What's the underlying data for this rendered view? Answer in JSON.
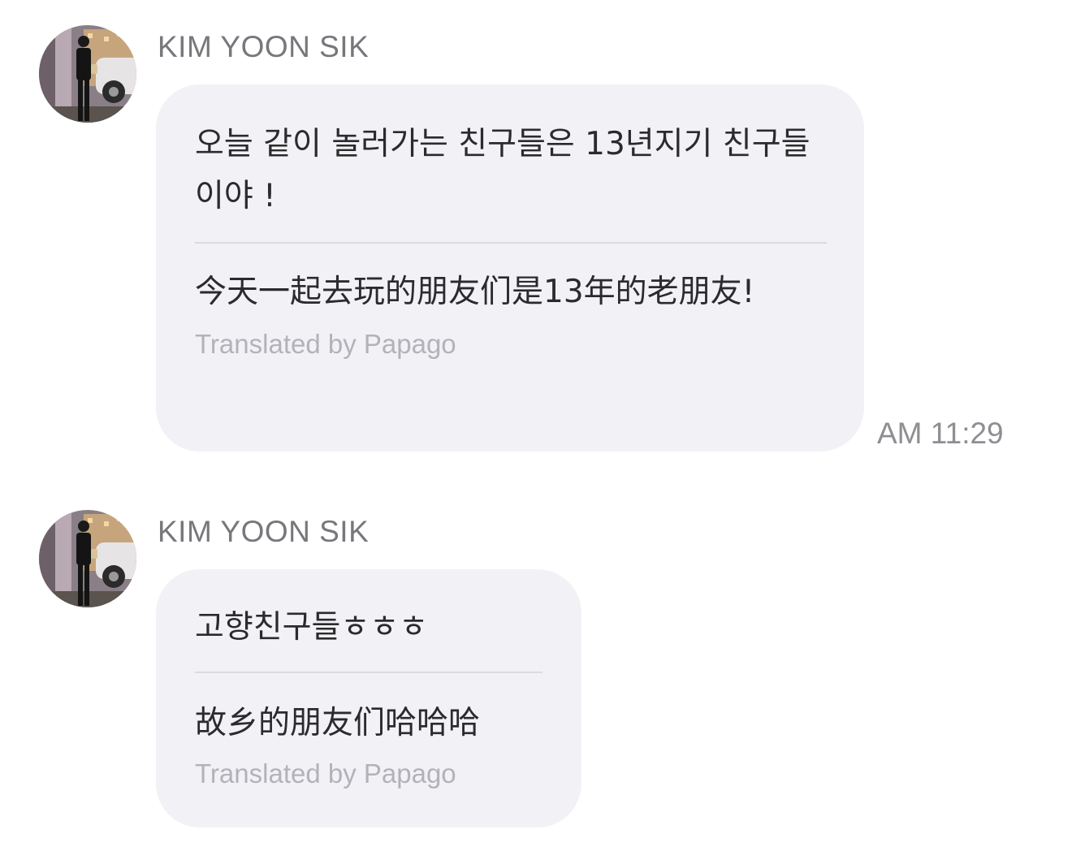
{
  "messages": [
    {
      "sender": "KIM YOON SIK",
      "avatar_icon": "profile-photo",
      "original": "오늘 같이 놀러가는 친구들은 13년지기 친구들이야 !",
      "translation": "今天一起去玩的朋友们是13年的老朋友!",
      "translation_credit": "Translated by Papago",
      "time": "AM 11:29"
    },
    {
      "sender": "KIM YOON SIK",
      "avatar_icon": "profile-photo",
      "original": "고향친구들ㅎㅎㅎ",
      "translation": "故乡的朋友们哈哈哈",
      "translation_credit": "Translated by Papago"
    }
  ],
  "colors": {
    "bubble": "#f2f2f6",
    "sender": "#77777c",
    "credit": "#b2b2b8",
    "timestamp": "#8e8e93"
  }
}
